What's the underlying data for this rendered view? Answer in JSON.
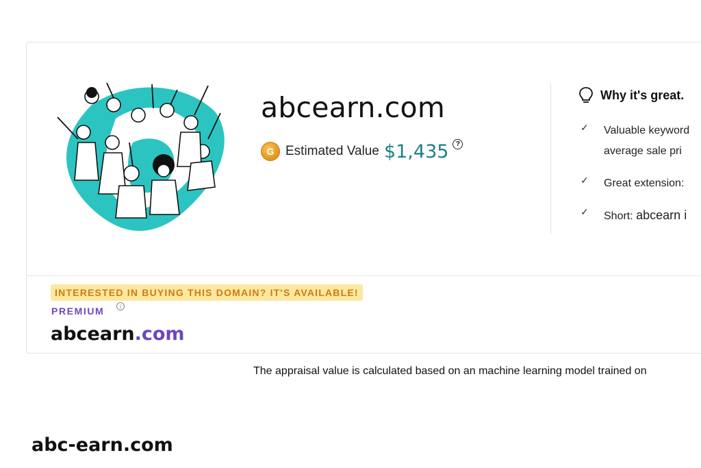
{
  "domain": "abcearn.com",
  "estimate": {
    "label": "Estimated Value",
    "value": "$1,435",
    "coin_letter": "G",
    "help_glyph": "?"
  },
  "why": {
    "title": "Why it's great.",
    "bullets": [
      {
        "line1": "Valuable keyword",
        "line2": "average sale pri"
      },
      {
        "line1": "Great extension:"
      },
      {
        "prefix": "Short: ",
        "strong": "abcearn i"
      }
    ]
  },
  "premium": {
    "banner": "INTERESTED IN BUYING THIS DOMAIN? IT'S AVAILABLE!",
    "label": "PREMIUM",
    "info_glyph": "i",
    "sld": "abcearn",
    "tld": ".com"
  },
  "appraisal_note": "The appraisal value is calculated based on an machine learning model trained on",
  "alt_domain": "abc-earn.com",
  "icons": [
    "coin-icon",
    "help-icon",
    "lightbulb-icon",
    "check-icon",
    "info-icon"
  ],
  "colors": {
    "accent_teal": "#1b7f86",
    "brand_purple": "#6b47c1",
    "banner_bg": "#fde8a0",
    "banner_text": "#cf7a11",
    "illustration_teal": "#2cc4c1"
  }
}
